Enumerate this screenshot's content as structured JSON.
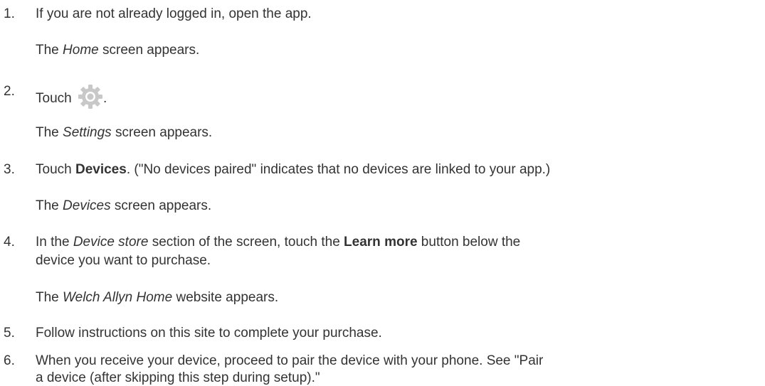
{
  "steps": [
    {
      "number": "1.",
      "text": "If you are not already logged in, open the app.",
      "result_pre": "The ",
      "result_italic": "Home",
      "result_post": " screen appears."
    },
    {
      "number": "2.",
      "text_pre": "Touch ",
      "icon": "gear-icon",
      "text_post": ".",
      "result_pre": "The ",
      "result_italic": "Settings",
      "result_post": " screen appears."
    },
    {
      "number": "3.",
      "text_pre": "Touch ",
      "text_bold": "Devices",
      "text_post": ". (\"No devices paired\" indicates that no devices are linked to your app.)",
      "result_pre": "The ",
      "result_italic": "Devices",
      "result_post": " screen appears."
    },
    {
      "number": "4.",
      "text_pre": "In the ",
      "text_italic": "Device store",
      "text_mid": " section of the screen, touch the ",
      "text_bold": "Learn more",
      "text_post": " button below the",
      "text_line2": "device you want to purchase.",
      "result_pre": "The ",
      "result_italic": "Welch Allyn Home",
      "result_post": " website appears."
    },
    {
      "number": "5.",
      "text": "Follow instructions on this site to complete your purchase."
    },
    {
      "number": "6.",
      "text": "When you receive your device, proceed to pair the device with your phone. See \"Pair",
      "text_line2": "a device (after skipping this step during setup).\""
    }
  ],
  "colors": {
    "text": "#333333",
    "icon": "#c8c8c8"
  }
}
